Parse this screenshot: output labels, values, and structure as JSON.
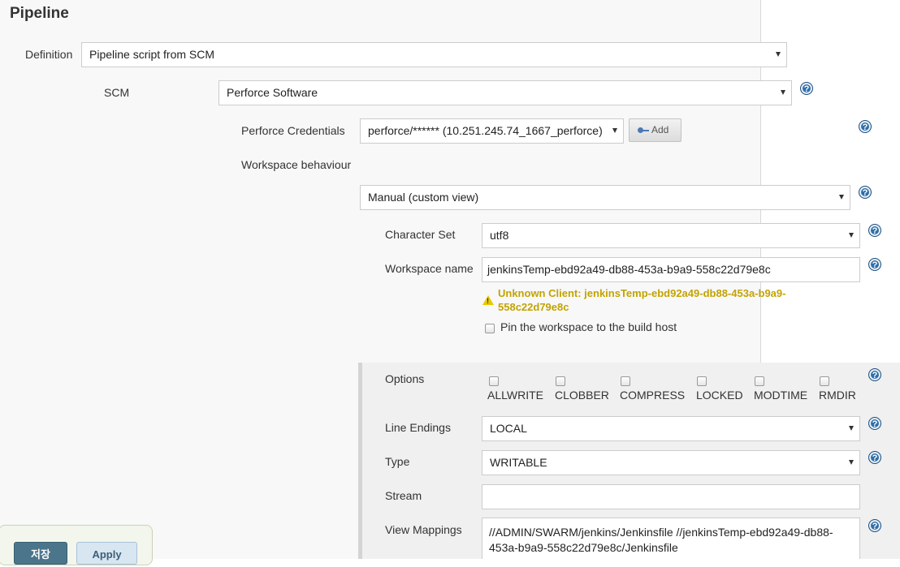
{
  "section": {
    "title": "Pipeline"
  },
  "definition": {
    "label": "Definition",
    "value": "Pipeline script from SCM"
  },
  "scm": {
    "label": "SCM",
    "value": "Perforce Software"
  },
  "credentials": {
    "label": "Perforce Credentials",
    "value": "perforce/****** (10.251.245.74_1667_perforce)",
    "add_label": "Add"
  },
  "workspace_behaviour": {
    "label": "Workspace behaviour",
    "value": "Manual (custom view)"
  },
  "charset": {
    "label": "Character Set",
    "value": "utf8"
  },
  "workspace_name": {
    "label": "Workspace name",
    "value": "jenkinsTemp-ebd92a49-db88-453a-b9a9-558c22d79e8c",
    "warning": "Unknown Client: jenkinsTemp-ebd92a49-db88-453a-b9a9-558c22d79e8c"
  },
  "pin": {
    "label": "Pin the workspace to the build host",
    "checked": false
  },
  "options": {
    "label": "Options",
    "items": [
      {
        "label": "ALLWRITE",
        "checked": false
      },
      {
        "label": "CLOBBER",
        "checked": false
      },
      {
        "label": "COMPRESS",
        "checked": false
      },
      {
        "label": "LOCKED",
        "checked": false
      },
      {
        "label": "MODTIME",
        "checked": false
      },
      {
        "label": "RMDIR",
        "checked": false
      }
    ]
  },
  "line_endings": {
    "label": "Line Endings",
    "value": "LOCAL"
  },
  "type": {
    "label": "Type",
    "value": "WRITABLE"
  },
  "stream": {
    "label": "Stream",
    "value": ""
  },
  "view_mappings": {
    "label": "View Mappings",
    "value": "//ADMIN/SWARM/jenkins/Jenkinsfile //jenkinsTemp-ebd92a49-db88-453a-b9a9-558c22d79e8c/Jenkinsfile"
  },
  "buttons": {
    "save_label": "저장",
    "apply_label": "Apply"
  },
  "help_icon_glyph": "?",
  "colors": {
    "warning": "#c3a300",
    "help": "#2f6fa8",
    "save_button": "#4b758b"
  }
}
